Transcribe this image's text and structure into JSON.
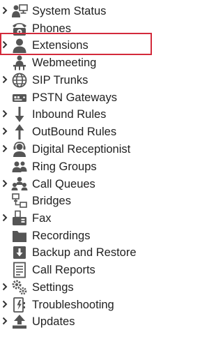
{
  "colors": {
    "highlight": "#d32a3b",
    "icon": "#555555",
    "chevron": "#333333",
    "text": "#222222"
  },
  "nav": {
    "items": [
      {
        "label": "System Status",
        "icon": "system-status-icon",
        "expandable": true
      },
      {
        "label": "Phones",
        "icon": "phone-icon",
        "expandable": false
      },
      {
        "label": "Extensions",
        "icon": "extension-user-icon",
        "expandable": true,
        "highlighted": true
      },
      {
        "label": "Webmeeting",
        "icon": "webmeeting-icon",
        "expandable": false
      },
      {
        "label": "SIP Trunks",
        "icon": "globe-icon",
        "expandable": true
      },
      {
        "label": "PSTN Gateways",
        "icon": "gateway-icon",
        "expandable": false
      },
      {
        "label": "Inbound Rules",
        "icon": "arrow-down-icon",
        "expandable": true
      },
      {
        "label": "OutBound Rules",
        "icon": "arrow-up-icon",
        "expandable": true
      },
      {
        "label": "Digital Receptionist",
        "icon": "receptionist-icon",
        "expandable": true
      },
      {
        "label": "Ring Groups",
        "icon": "ring-group-icon",
        "expandable": false
      },
      {
        "label": "Call Queues",
        "icon": "call-queue-icon",
        "expandable": true
      },
      {
        "label": "Bridges",
        "icon": "bridge-icon",
        "expandable": false
      },
      {
        "label": "Fax",
        "icon": "fax-icon",
        "expandable": true
      },
      {
        "label": "Recordings",
        "icon": "folder-icon",
        "expandable": false
      },
      {
        "label": "Backup and Restore",
        "icon": "backup-icon",
        "expandable": false
      },
      {
        "label": "Call Reports",
        "icon": "report-icon",
        "expandable": false
      },
      {
        "label": "Settings",
        "icon": "gears-icon",
        "expandable": true
      },
      {
        "label": "Troubleshooting",
        "icon": "troubleshooting-icon",
        "expandable": true
      },
      {
        "label": "Updates",
        "icon": "upload-icon",
        "expandable": true
      }
    ]
  }
}
